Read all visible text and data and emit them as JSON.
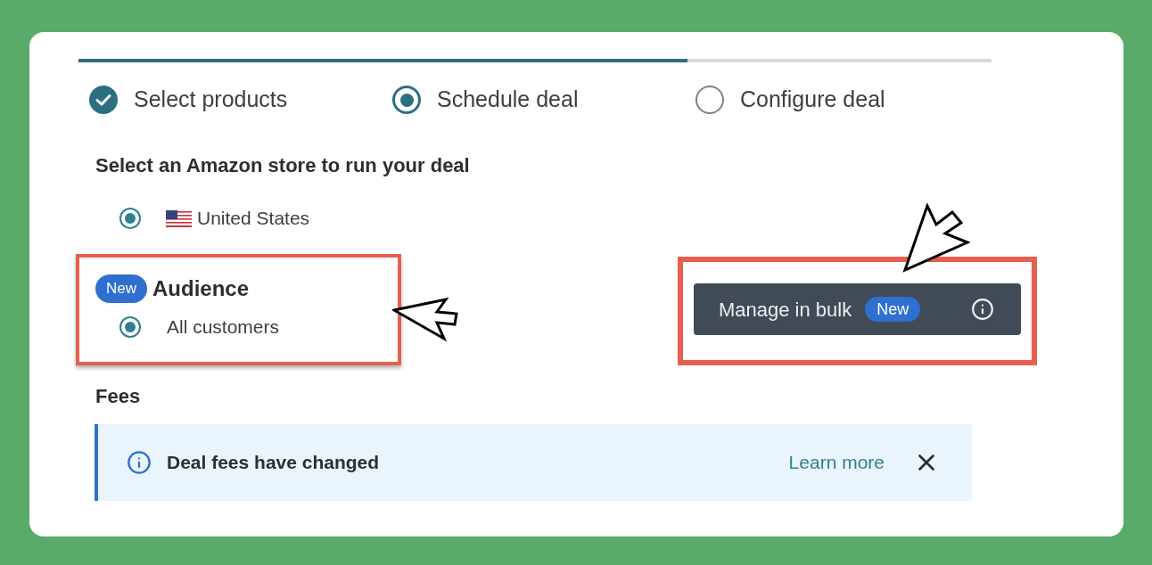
{
  "progress": {
    "level": 0.667
  },
  "steps": [
    {
      "label": "Select products",
      "kind": "complete"
    },
    {
      "label": "Schedule deal",
      "kind": "current"
    },
    {
      "label": "Configure deal",
      "kind": "pending"
    }
  ],
  "store": {
    "heading": "Select an Amazon store to run your deal",
    "options": [
      {
        "label": "United States",
        "selected": true
      }
    ]
  },
  "audience": {
    "badge": "New",
    "heading": "Audience",
    "options": [
      {
        "label": "All customers",
        "selected": true
      }
    ]
  },
  "bulk_button": {
    "label": "Manage in bulk",
    "badge": "New"
  },
  "fees": {
    "heading": "Fees",
    "alert": {
      "message": "Deal fees have changed",
      "link": "Learn more"
    }
  }
}
